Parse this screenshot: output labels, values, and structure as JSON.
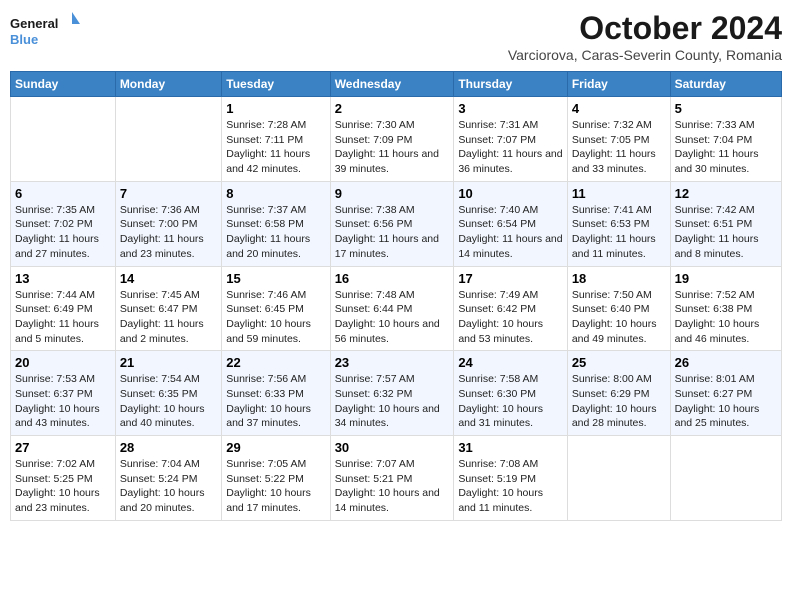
{
  "header": {
    "logo_general": "General",
    "logo_blue": "Blue",
    "title": "October 2024",
    "subtitle": "Varciorova, Caras-Severin County, Romania"
  },
  "weekdays": [
    "Sunday",
    "Monday",
    "Tuesday",
    "Wednesday",
    "Thursday",
    "Friday",
    "Saturday"
  ],
  "weeks": [
    [
      {
        "day": "",
        "info": ""
      },
      {
        "day": "",
        "info": ""
      },
      {
        "day": "1",
        "info": "Sunrise: 7:28 AM\nSunset: 7:11 PM\nDaylight: 11 hours and 42 minutes."
      },
      {
        "day": "2",
        "info": "Sunrise: 7:30 AM\nSunset: 7:09 PM\nDaylight: 11 hours and 39 minutes."
      },
      {
        "day": "3",
        "info": "Sunrise: 7:31 AM\nSunset: 7:07 PM\nDaylight: 11 hours and 36 minutes."
      },
      {
        "day": "4",
        "info": "Sunrise: 7:32 AM\nSunset: 7:05 PM\nDaylight: 11 hours and 33 minutes."
      },
      {
        "day": "5",
        "info": "Sunrise: 7:33 AM\nSunset: 7:04 PM\nDaylight: 11 hours and 30 minutes."
      }
    ],
    [
      {
        "day": "6",
        "info": "Sunrise: 7:35 AM\nSunset: 7:02 PM\nDaylight: 11 hours and 27 minutes."
      },
      {
        "day": "7",
        "info": "Sunrise: 7:36 AM\nSunset: 7:00 PM\nDaylight: 11 hours and 23 minutes."
      },
      {
        "day": "8",
        "info": "Sunrise: 7:37 AM\nSunset: 6:58 PM\nDaylight: 11 hours and 20 minutes."
      },
      {
        "day": "9",
        "info": "Sunrise: 7:38 AM\nSunset: 6:56 PM\nDaylight: 11 hours and 17 minutes."
      },
      {
        "day": "10",
        "info": "Sunrise: 7:40 AM\nSunset: 6:54 PM\nDaylight: 11 hours and 14 minutes."
      },
      {
        "day": "11",
        "info": "Sunrise: 7:41 AM\nSunset: 6:53 PM\nDaylight: 11 hours and 11 minutes."
      },
      {
        "day": "12",
        "info": "Sunrise: 7:42 AM\nSunset: 6:51 PM\nDaylight: 11 hours and 8 minutes."
      }
    ],
    [
      {
        "day": "13",
        "info": "Sunrise: 7:44 AM\nSunset: 6:49 PM\nDaylight: 11 hours and 5 minutes."
      },
      {
        "day": "14",
        "info": "Sunrise: 7:45 AM\nSunset: 6:47 PM\nDaylight: 11 hours and 2 minutes."
      },
      {
        "day": "15",
        "info": "Sunrise: 7:46 AM\nSunset: 6:45 PM\nDaylight: 10 hours and 59 minutes."
      },
      {
        "day": "16",
        "info": "Sunrise: 7:48 AM\nSunset: 6:44 PM\nDaylight: 10 hours and 56 minutes."
      },
      {
        "day": "17",
        "info": "Sunrise: 7:49 AM\nSunset: 6:42 PM\nDaylight: 10 hours and 53 minutes."
      },
      {
        "day": "18",
        "info": "Sunrise: 7:50 AM\nSunset: 6:40 PM\nDaylight: 10 hours and 49 minutes."
      },
      {
        "day": "19",
        "info": "Sunrise: 7:52 AM\nSunset: 6:38 PM\nDaylight: 10 hours and 46 minutes."
      }
    ],
    [
      {
        "day": "20",
        "info": "Sunrise: 7:53 AM\nSunset: 6:37 PM\nDaylight: 10 hours and 43 minutes."
      },
      {
        "day": "21",
        "info": "Sunrise: 7:54 AM\nSunset: 6:35 PM\nDaylight: 10 hours and 40 minutes."
      },
      {
        "day": "22",
        "info": "Sunrise: 7:56 AM\nSunset: 6:33 PM\nDaylight: 10 hours and 37 minutes."
      },
      {
        "day": "23",
        "info": "Sunrise: 7:57 AM\nSunset: 6:32 PM\nDaylight: 10 hours and 34 minutes."
      },
      {
        "day": "24",
        "info": "Sunrise: 7:58 AM\nSunset: 6:30 PM\nDaylight: 10 hours and 31 minutes."
      },
      {
        "day": "25",
        "info": "Sunrise: 8:00 AM\nSunset: 6:29 PM\nDaylight: 10 hours and 28 minutes."
      },
      {
        "day": "26",
        "info": "Sunrise: 8:01 AM\nSunset: 6:27 PM\nDaylight: 10 hours and 25 minutes."
      }
    ],
    [
      {
        "day": "27",
        "info": "Sunrise: 7:02 AM\nSunset: 5:25 PM\nDaylight: 10 hours and 23 minutes."
      },
      {
        "day": "28",
        "info": "Sunrise: 7:04 AM\nSunset: 5:24 PM\nDaylight: 10 hours and 20 minutes."
      },
      {
        "day": "29",
        "info": "Sunrise: 7:05 AM\nSunset: 5:22 PM\nDaylight: 10 hours and 17 minutes."
      },
      {
        "day": "30",
        "info": "Sunrise: 7:07 AM\nSunset: 5:21 PM\nDaylight: 10 hours and 14 minutes."
      },
      {
        "day": "31",
        "info": "Sunrise: 7:08 AM\nSunset: 5:19 PM\nDaylight: 10 hours and 11 minutes."
      },
      {
        "day": "",
        "info": ""
      },
      {
        "day": "",
        "info": ""
      }
    ]
  ]
}
